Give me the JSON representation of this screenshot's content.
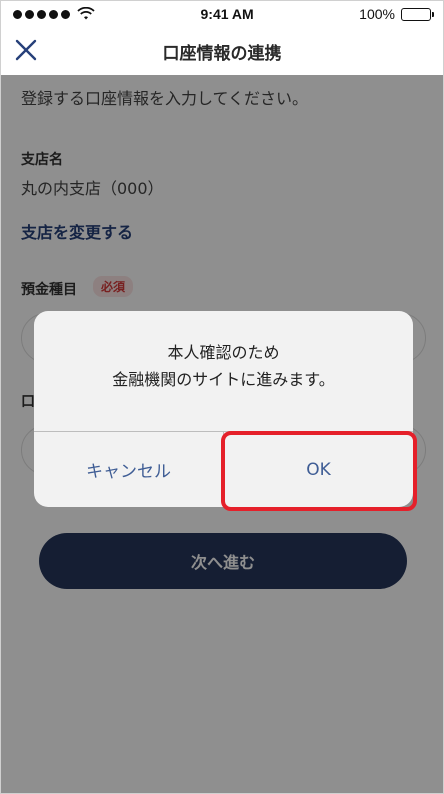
{
  "status_bar": {
    "time": "9:41 AM",
    "battery": "100%",
    "signal_filled": 5,
    "signal_total": 5
  },
  "nav": {
    "title": "口座情報の連携",
    "close_icon": "close-icon"
  },
  "form": {
    "intro": "登録する口座情報を入力してください。",
    "branch_label": "支店名",
    "branch_value": "丸の内支店（000）",
    "change_branch": "支店を変更する",
    "deposit_type_label": "預金種目",
    "required_badge": "必須",
    "account_number_label": "口",
    "next_button": "次へ進む"
  },
  "alert": {
    "line1": "本人確認のため",
    "line2": "金融機関のサイトに進みます。",
    "cancel_label": "キャンセル",
    "ok_label": "OK"
  },
  "colors": {
    "accent": "#27407a",
    "button_dark": "#27375c",
    "highlight": "#e5202a",
    "alert_button_text": "#3f5d95"
  }
}
